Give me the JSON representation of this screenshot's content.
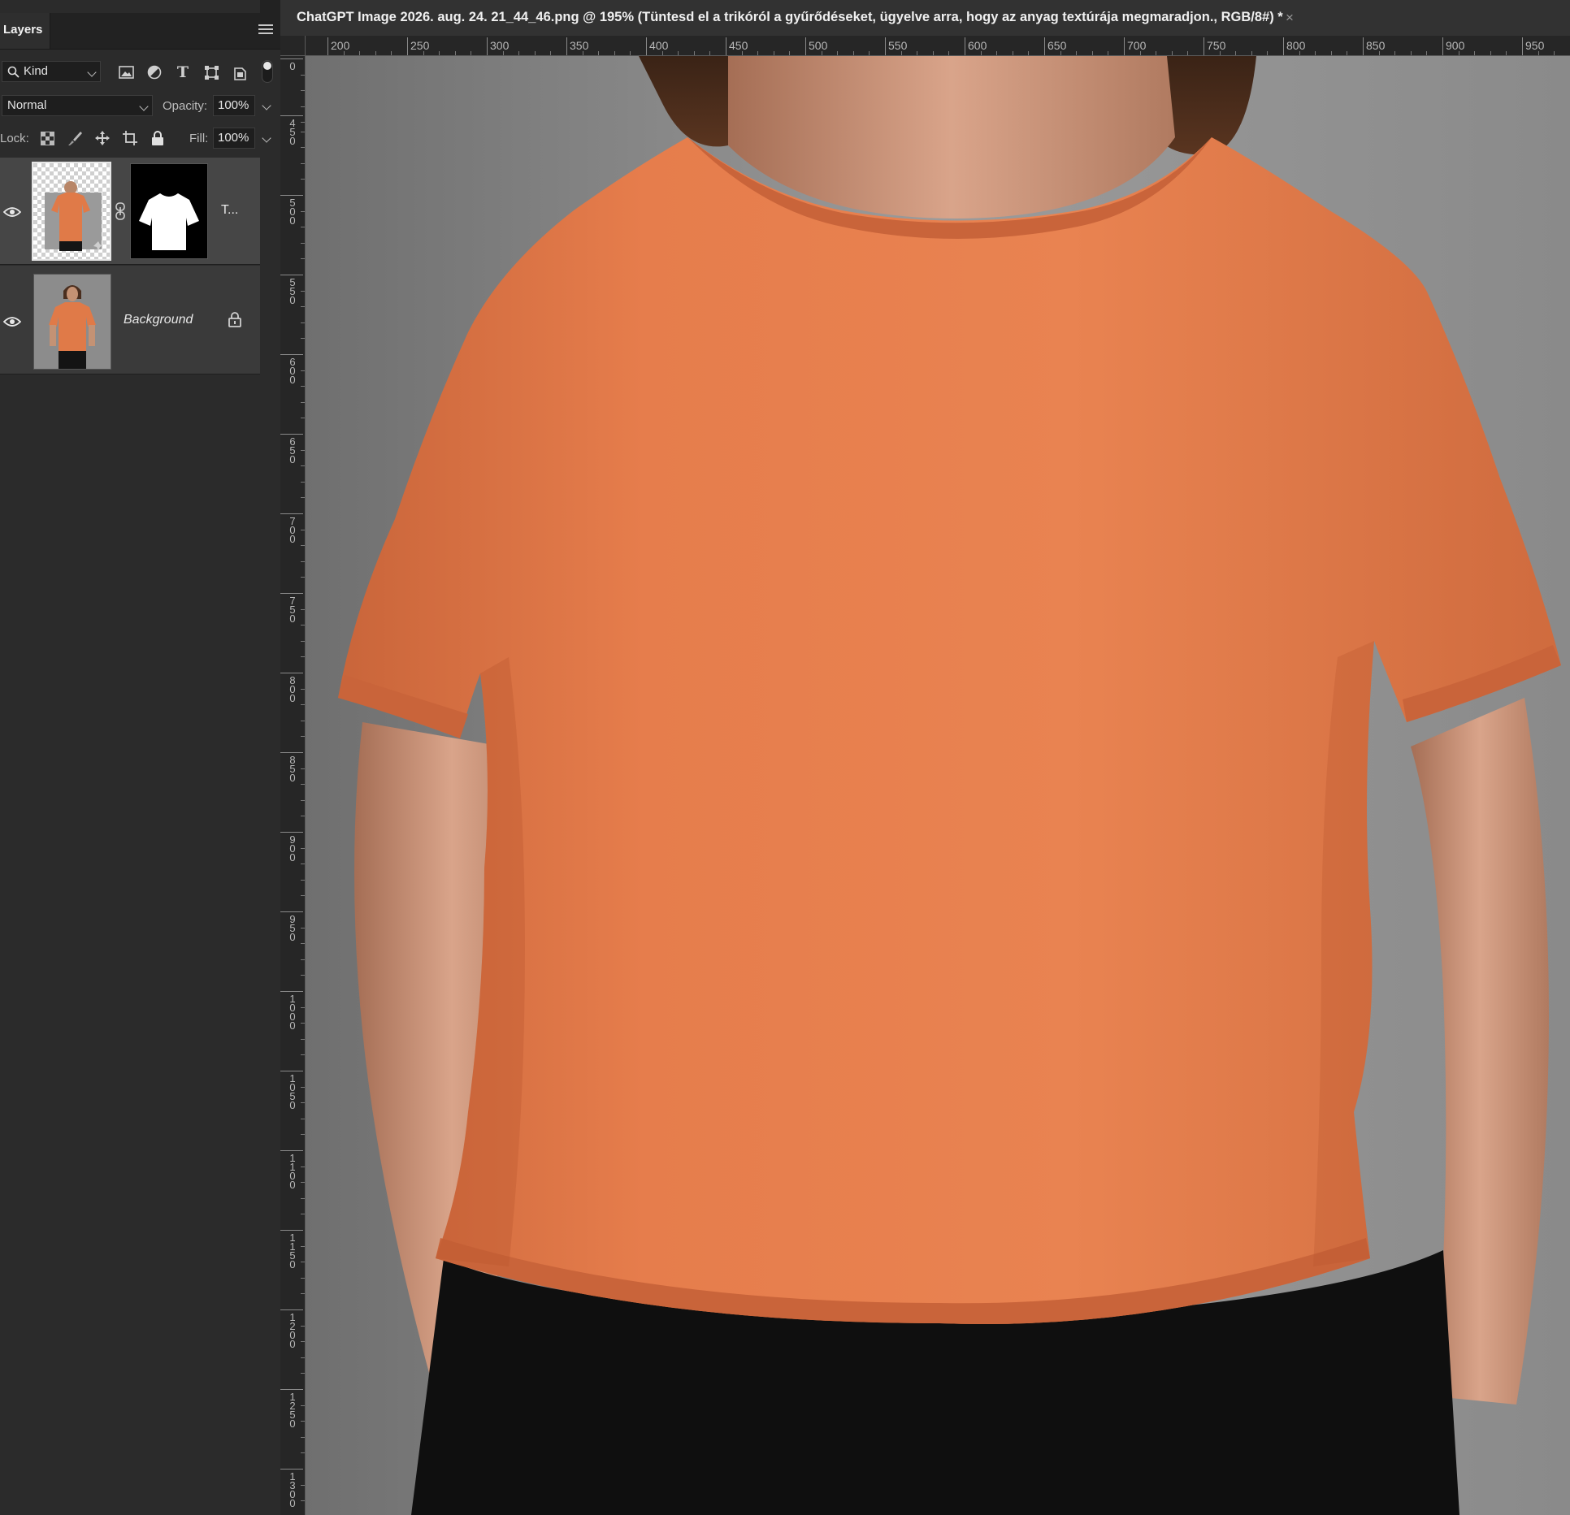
{
  "collapse_glyph": "‹‹",
  "panel": {
    "tab_label": "Layers",
    "menu_icon": "hamburger-menu-icon"
  },
  "filter": {
    "kind_label": "Kind",
    "icons": [
      "image-filter-icon",
      "adjustment-filter-icon",
      "type-filter-icon",
      "shape-filter-icon",
      "smart-object-filter-icon"
    ],
    "type_glyph": "T"
  },
  "blend": {
    "mode": "Normal",
    "opacity_label": "Opacity:",
    "opacity_value": "100%"
  },
  "lock": {
    "label": "Lock:",
    "icons": [
      "lock-transparent-pixels-icon",
      "lock-image-pixels-icon",
      "lock-position-icon",
      "lock-artboard-icon",
      "lock-all-icon"
    ],
    "fill_label": "Fill:",
    "fill_value": "100%"
  },
  "layers": [
    {
      "name": "T...",
      "visible": true,
      "selected": true,
      "has_mask": true,
      "locked": false
    },
    {
      "name": "Background",
      "visible": true,
      "selected": false,
      "has_mask": false,
      "locked": true
    }
  ],
  "document": {
    "title": "ChatGPT Image 2026. aug. 24. 21_44_46.png @ 195% (Tüntesd el a trikóról a gyűrődéseket, ügyelve arra, hogy az anyag textúrája megmaradjon., RGB/8#) *",
    "close_glyph": "×",
    "zoom": "195%"
  },
  "ruler_h_labels": [
    "200",
    "250",
    "300",
    "350",
    "400",
    "450",
    "500",
    "550",
    "600",
    "650",
    "700",
    "750",
    "800",
    "850",
    "900",
    "950"
  ],
  "ruler_v_labels": [
    "0",
    "450",
    "500",
    "550",
    "600",
    "650",
    "700",
    "750",
    "800",
    "850",
    "900",
    "950",
    "1000",
    "1050",
    "1100",
    "1150",
    "1200",
    "1250",
    "1300"
  ],
  "colors": {
    "shirt": "#e07a48",
    "backdrop": "#8e8e8e",
    "panel": "#2b2b2b",
    "selected_layer": "#464646"
  }
}
